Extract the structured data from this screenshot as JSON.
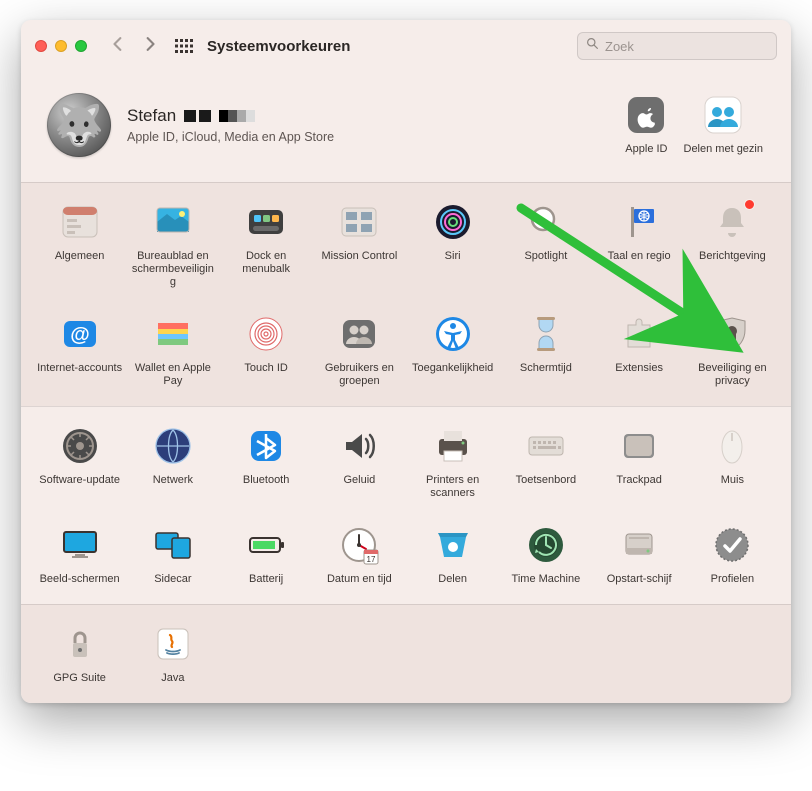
{
  "window": {
    "title": "Systeemvoorkeuren"
  },
  "search": {
    "placeholder": "Zoek"
  },
  "user": {
    "name": "Stefan",
    "subtitle": "Apple ID, iCloud, Media en App Store"
  },
  "header_prefs": [
    {
      "id": "appleid",
      "label": "Apple ID"
    },
    {
      "id": "family",
      "label": "Delen met gezin"
    }
  ],
  "sections": [
    {
      "alt": true,
      "rows": [
        [
          {
            "id": "general",
            "label": "Algemeen"
          },
          {
            "id": "desktop",
            "label": "Bureaublad en schermbeveiliging"
          },
          {
            "id": "dock",
            "label": "Dock en menubalk"
          },
          {
            "id": "mission",
            "label": "Mission Control"
          },
          {
            "id": "siri",
            "label": "Siri"
          },
          {
            "id": "spotlight",
            "label": "Spotlight"
          },
          {
            "id": "language",
            "label": "Taal en regio"
          },
          {
            "id": "notifications",
            "label": "Berichtgeving",
            "badge": true
          }
        ],
        [
          {
            "id": "internet",
            "label": "Internet-accounts"
          },
          {
            "id": "wallet",
            "label": "Wallet en Apple Pay"
          },
          {
            "id": "touchid",
            "label": "Touch ID"
          },
          {
            "id": "users",
            "label": "Gebruikers en groepen"
          },
          {
            "id": "a11y",
            "label": "Toegankelijkheid"
          },
          {
            "id": "screentime",
            "label": "Schermtijd"
          },
          {
            "id": "extensions",
            "label": "Extensies"
          },
          {
            "id": "security",
            "label": "Beveiliging en privacy"
          }
        ]
      ]
    },
    {
      "alt": false,
      "rows": [
        [
          {
            "id": "update",
            "label": "Software-update"
          },
          {
            "id": "network",
            "label": "Netwerk"
          },
          {
            "id": "bluetooth",
            "label": "Bluetooth"
          },
          {
            "id": "sound",
            "label": "Geluid"
          },
          {
            "id": "printers",
            "label": "Printers en scanners"
          },
          {
            "id": "keyboard",
            "label": "Toetsenbord"
          },
          {
            "id": "trackpad",
            "label": "Trackpad"
          },
          {
            "id": "mouse",
            "label": "Muis"
          }
        ],
        [
          {
            "id": "displays",
            "label": "Beeld-schermen"
          },
          {
            "id": "sidecar",
            "label": "Sidecar"
          },
          {
            "id": "battery",
            "label": "Batterij"
          },
          {
            "id": "datetime",
            "label": "Datum en tijd"
          },
          {
            "id": "sharing",
            "label": "Delen"
          },
          {
            "id": "timemachine",
            "label": "Time Machine"
          },
          {
            "id": "startup",
            "label": "Opstart-schijf"
          },
          {
            "id": "profiles",
            "label": "Profielen"
          }
        ]
      ]
    },
    {
      "alt": true,
      "rows": [
        [
          {
            "id": "gpg",
            "label": "GPG Suite"
          },
          {
            "id": "java",
            "label": "Java"
          }
        ]
      ]
    }
  ]
}
